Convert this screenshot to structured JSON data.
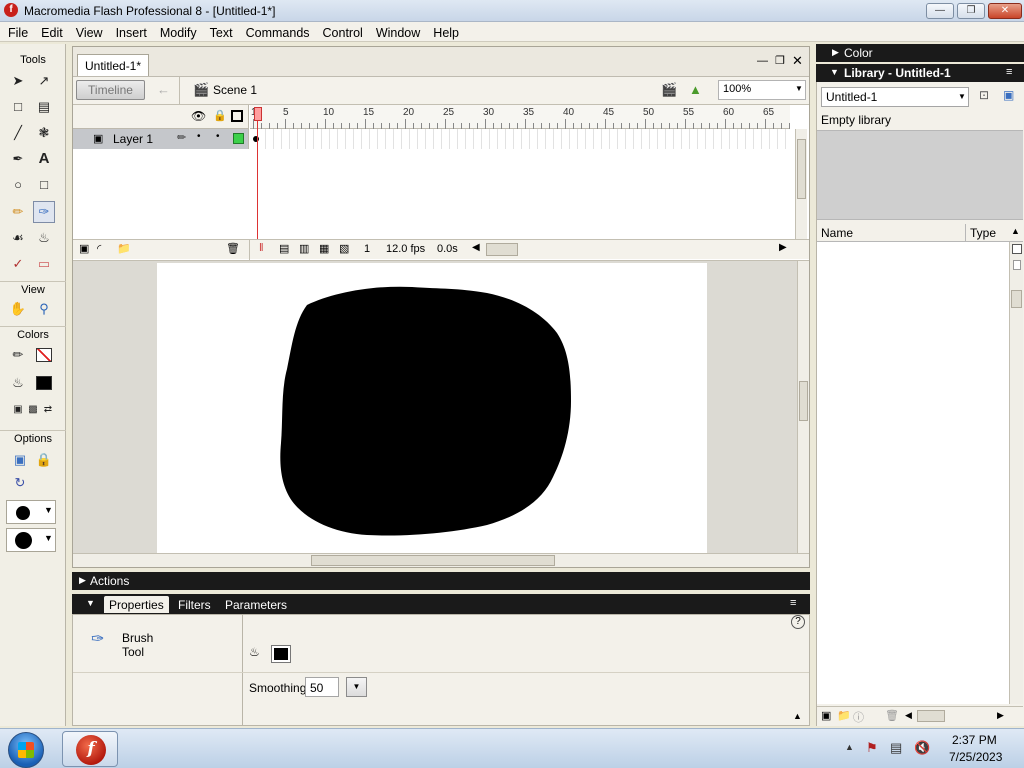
{
  "window": {
    "title": "Macromedia Flash Professional 8 - [Untitled-1*]"
  },
  "menu": [
    "File",
    "Edit",
    "View",
    "Insert",
    "Modify",
    "Text",
    "Commands",
    "Control",
    "Window",
    "Help"
  ],
  "tools": {
    "heading": "Tools",
    "view_heading": "View",
    "colors_heading": "Colors",
    "options_heading": "Options",
    "selected_tool": "brush-tool"
  },
  "document": {
    "tab_label": "Untitled-1*",
    "timeline_button": "Timeline",
    "scene_label": "Scene 1",
    "zoom": "100%"
  },
  "timeline": {
    "layer_name": "Layer 1",
    "ruler_ticks": [
      "1",
      "5",
      "10",
      "15",
      "20",
      "25",
      "30",
      "35",
      "40",
      "45",
      "50",
      "55",
      "60",
      "65"
    ],
    "current_frame": "1",
    "frame_rate": "12.0 fps",
    "elapsed": "0.0s"
  },
  "panels": {
    "actions": "Actions",
    "properties_tabs": [
      "Properties",
      "Filters",
      "Parameters"
    ],
    "tool_name_line1": "Brush",
    "tool_name_line2": "Tool",
    "smoothing_label": "Smoothing",
    "smoothing_value": "50"
  },
  "right": {
    "color_panel": "Color",
    "library_panel": "Library - Untitled-1",
    "library_select": "Untitled-1",
    "library_status": "Empty library",
    "col_name": "Name",
    "col_type": "Type"
  },
  "taskbar": {
    "time": "2:37 PM",
    "date": "7/25/2023"
  },
  "colors": {
    "fill": "#000000",
    "accent": "#c8201a",
    "panel_header": "#1a1a1a"
  }
}
